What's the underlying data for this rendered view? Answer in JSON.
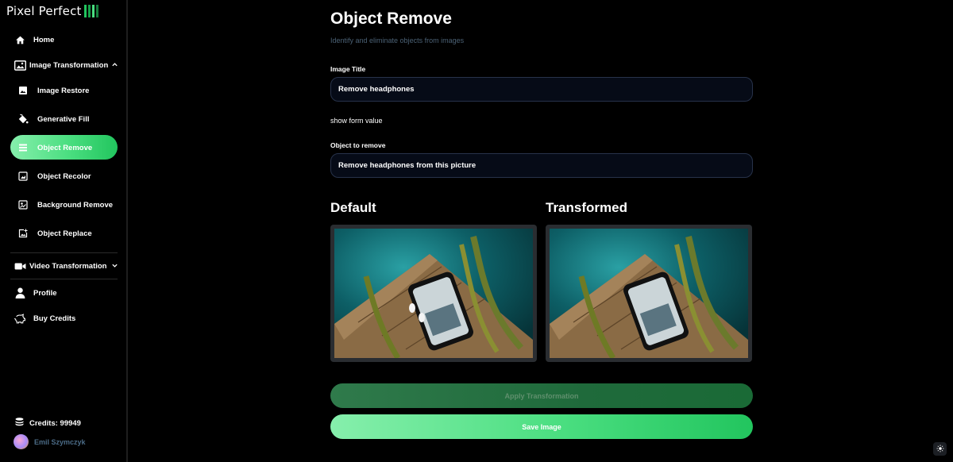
{
  "app": {
    "logo_text": "Pixel Perfect"
  },
  "sidebar": {
    "home": "Home",
    "image_section": "Image Transformation",
    "image_items": [
      {
        "label": "Image Restore",
        "icon": "image-icon"
      },
      {
        "label": "Generative Fill",
        "icon": "paint-bucket-icon"
      },
      {
        "label": "Object Remove",
        "icon": "layers-icon",
        "active": true
      },
      {
        "label": "Object Recolor",
        "icon": "recolor-icon"
      },
      {
        "label": "Background Remove",
        "icon": "background-icon"
      },
      {
        "label": "Object Replace",
        "icon": "image-plus-icon"
      }
    ],
    "video_section": "Video Transformation",
    "profile": "Profile",
    "buy_credits": "Buy Credits",
    "credits_label": "Credits: 99949",
    "user_name": "Emil Szymczyk"
  },
  "main": {
    "title": "Object Remove",
    "subtitle": "Identify and eliminate objects from images",
    "image_title_label": "Image Title",
    "image_title_value": "Remove headphones",
    "show_form_value": "show form value",
    "object_label": "Object to remove",
    "object_value": "Remove headphones from this picture",
    "default_heading": "Default",
    "transformed_heading": "Transformed",
    "apply_button": "Apply Transformation",
    "save_button": "Save Image"
  },
  "colors": {
    "accent": "#22c55e",
    "accent_light": "#86efac",
    "field_bg": "#060b17",
    "background": "#000000"
  }
}
